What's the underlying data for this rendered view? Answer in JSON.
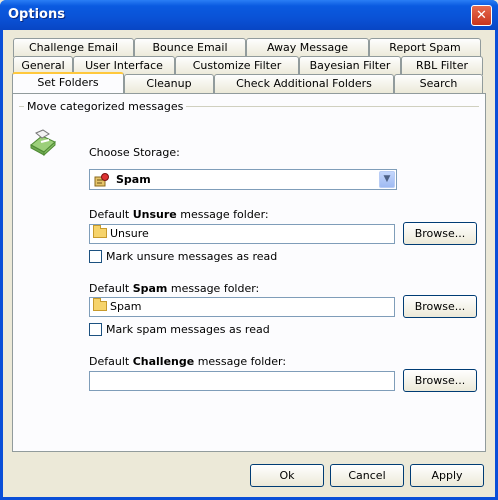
{
  "window": {
    "title": "Options",
    "close_glyph": "✕"
  },
  "tabs": {
    "row1": [
      "Challenge Email",
      "Bounce Email",
      "Away Message",
      "Report Spam"
    ],
    "row2": [
      "General",
      "User Interface",
      "Customize Filter",
      "Bayesian Filter",
      "RBL Filter"
    ],
    "row3": [
      "Set Folders",
      "Cleanup",
      "Check Additional Folders",
      "Search"
    ],
    "active": "Set Folders"
  },
  "panel": {
    "group_label": "Move categorized messages",
    "storage": {
      "label": "Choose Storage:",
      "selected": "Spam",
      "icon": "storage-icon",
      "arrow_glyph": "▼"
    },
    "unsure": {
      "label_prefix": "Default ",
      "label_bold": "Unsure",
      "label_suffix": " message folder:",
      "value": "Unsure",
      "browse": "Browse...",
      "checkbox_label": "Mark unsure messages as read"
    },
    "spam": {
      "label_prefix": "Default ",
      "label_bold": "Spam",
      "label_suffix": " message folder:",
      "value": "Spam",
      "browse": "Browse...",
      "checkbox_label": "Mark spam messages as read"
    },
    "challenge": {
      "label_prefix": "Default ",
      "label_bold": "Challenge",
      "label_suffix": " message folder:",
      "value": "",
      "browse": "Browse..."
    }
  },
  "footer": {
    "ok": "Ok",
    "cancel": "Cancel",
    "apply": "Apply"
  }
}
